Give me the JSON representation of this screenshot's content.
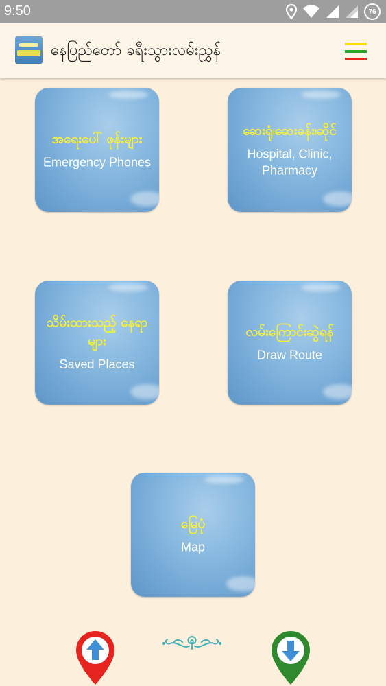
{
  "status_bar": {
    "time": "9:50",
    "battery": "76"
  },
  "app_bar": {
    "title": "နေပြည်တော် ခရီးသွားလမ်းညွှန်"
  },
  "tiles": [
    {
      "mm": "အရေးပေါ် ဖုန်းများ",
      "en": "Emergency Phones"
    },
    {
      "mm": "ဆေးရုံ၊ဆေးခန်း၊ဆိုင်",
      "en": "Hospital, Clinic, Pharmacy"
    },
    {
      "mm": "သိမ်းထားသည့် နေရာများ",
      "en": "Saved Places"
    },
    {
      "mm": "လမ်းကြောင်းဆွဲရန်",
      "en": "Draw Route"
    },
    {
      "mm": "မြေပုံ",
      "en": "Map"
    }
  ],
  "colors": {
    "background": "#fcefdc",
    "tile": "#7aaedb",
    "mm_text": "#f7f034",
    "up_pin": "#e52420",
    "down_pin": "#2f8a2f",
    "arrow": "#3f8fd6"
  },
  "icons": {
    "upload": "arrow-up-pin-icon",
    "download": "arrow-down-pin-icon",
    "ornament": "decorative-swirl-icon"
  }
}
